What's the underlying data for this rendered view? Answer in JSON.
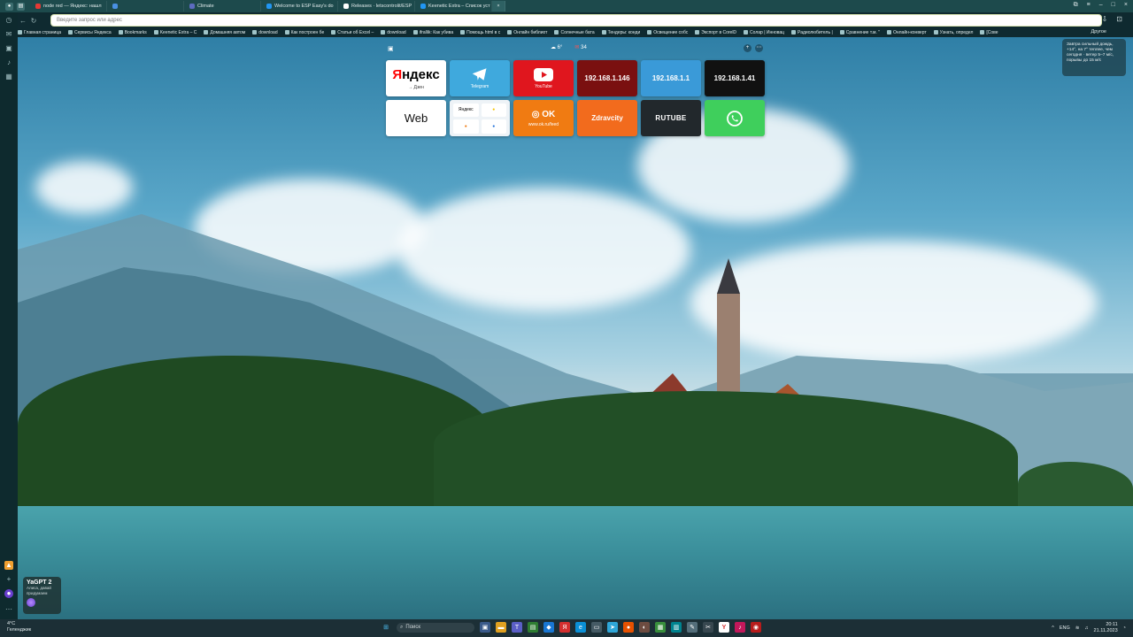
{
  "tabs": [
    {
      "label": "node red — Яндекс: нашл",
      "color": "#e53935"
    },
    {
      "label": "",
      "color": "#4a90e2"
    },
    {
      "label": "Climate",
      "color": "#5c6bc0"
    },
    {
      "label": "Welcome to ESP Easy's do",
      "color": "#2196f3"
    },
    {
      "label": "Releases · letscontrolit/ESP",
      "color": "#ffffff"
    },
    {
      "label": "Keenetic Extra – Список уст",
      "color": "#2196f3"
    }
  ],
  "address": {
    "placeholder": "Введите запрос или адрес"
  },
  "bookmarks": [
    "Главная страница",
    "Сервисы Яндекса",
    "Bookmarks",
    "Keenetic Extra – С",
    "Домашняя автом",
    "download",
    "Как построен бе",
    "Статьи об Excel –",
    "download",
    "ifrallik: Как убива",
    "Помощь html в с",
    "Онлайн библиот",
    "Солнечные бата",
    "Тендеры: конди",
    "Освещение собс",
    "Экспорт в CorelD",
    "Солар | Инновац",
    "Радиолюбитель |",
    "Сравнение т.м. \"",
    "Онлайн-конверт",
    "Узнать, определ",
    "[Сове"
  ],
  "bookmarks_other": "Другое",
  "weather": {
    "temp": "6°",
    "mail_count": "34"
  },
  "alice_hint": "Завтра сильный дождь, +14°, на 7° теплее, чем сегодня · ветер 5–7 м/с, порывы до 15 м/с",
  "tiles": [
    {
      "type": "yandex",
      "title": "Яндекс",
      "sub": "→ Дзен",
      "bg": "#ffffff"
    },
    {
      "type": "icon",
      "title": "",
      "sub": "Telegram",
      "bg": "#3fa9dd",
      "icon": "telegram-icon"
    },
    {
      "type": "icon",
      "title": "",
      "sub": "YouTube",
      "bg": "#e0161e",
      "icon": "youtube-icon"
    },
    {
      "type": "ip",
      "title": "192.168.1.146",
      "bg": "#7a1010"
    },
    {
      "type": "ip",
      "title": "192.168.1.1",
      "bg": "#3a9ad8"
    },
    {
      "type": "ip",
      "title": "192.168.1.41",
      "bg": "#111111"
    },
    {
      "type": "text",
      "title": "Web",
      "bg": "#ffffff",
      "fg": "#111"
    },
    {
      "type": "grid",
      "bg": "#eef3f7",
      "cells": [
        "Яндекс",
        "",
        "",
        ""
      ]
    },
    {
      "type": "ok",
      "title": "OK",
      "sub": "www.ok.ru/feed",
      "bg": "#f07b12"
    },
    {
      "type": "text",
      "title": "Zdravcity",
      "bg": "#f26b1d",
      "fg": "#fff"
    },
    {
      "type": "text",
      "title": "RUTUBE",
      "bg": "#22282c",
      "fg": "#fff"
    },
    {
      "type": "icon",
      "title": "",
      "sub": "",
      "bg": "#3fcf5c",
      "icon": "whatsapp-icon"
    }
  ],
  "yagpt": {
    "title": "YaGPT 2",
    "subtitle": "Алиса, давай придумаем"
  },
  "taskbar": {
    "weather_temp": "4°C",
    "weather_place": "Геленджик",
    "search_placeholder": "Поиск",
    "lang": "ENG",
    "time": "20:11",
    "date": "21.11.2023"
  }
}
